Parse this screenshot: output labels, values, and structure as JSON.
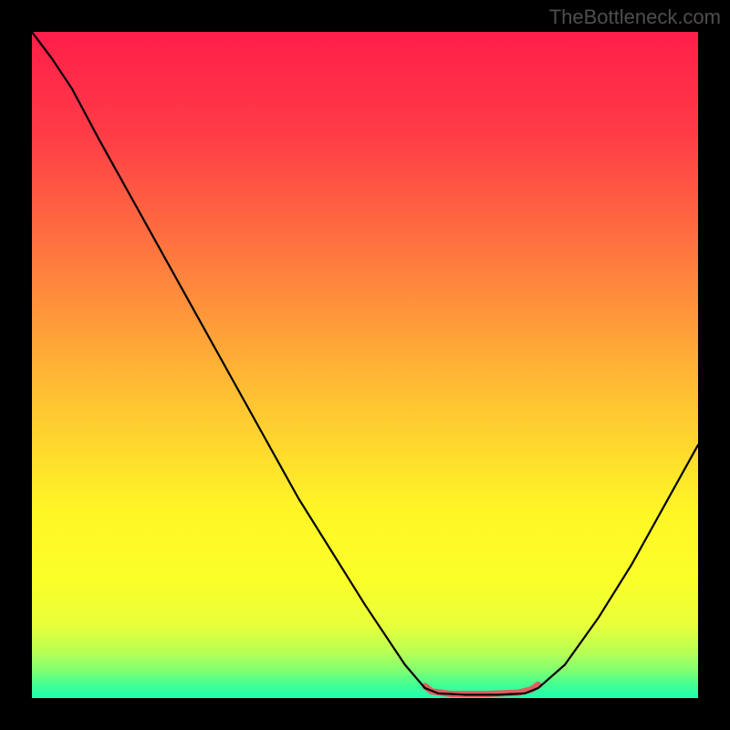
{
  "watermark": "TheBottleneck.com",
  "chart_data": {
    "type": "line",
    "title": "",
    "xlabel": "",
    "ylabel": "",
    "xlim": [
      0,
      100
    ],
    "ylim": [
      0,
      100
    ],
    "background_gradient_stops": [
      {
        "offset": 0,
        "color": "#ff1e49"
      },
      {
        "offset": 15,
        "color": "#ff3b47"
      },
      {
        "offset": 35,
        "color": "#ff7d3e"
      },
      {
        "offset": 55,
        "color": "#ffc233"
      },
      {
        "offset": 72,
        "color": "#fff626"
      },
      {
        "offset": 82,
        "color": "#fbff28"
      },
      {
        "offset": 89,
        "color": "#e8ff3a"
      },
      {
        "offset": 93,
        "color": "#baff53"
      },
      {
        "offset": 96,
        "color": "#7eff74"
      },
      {
        "offset": 98,
        "color": "#42ff93"
      },
      {
        "offset": 100,
        "color": "#1effb0"
      }
    ],
    "series": [
      {
        "name": "bottleneck-curve",
        "color": "#000000",
        "width": 2.2,
        "points": [
          {
            "x": 0,
            "y": 100
          },
          {
            "x": 3,
            "y": 96
          },
          {
            "x": 6,
            "y": 91.5
          },
          {
            "x": 10,
            "y": 84
          },
          {
            "x": 20,
            "y": 66
          },
          {
            "x": 30,
            "y": 48
          },
          {
            "x": 40,
            "y": 30
          },
          {
            "x": 50,
            "y": 14
          },
          {
            "x": 56,
            "y": 5
          },
          {
            "x": 59,
            "y": 1.5
          },
          {
            "x": 61,
            "y": 0.7
          },
          {
            "x": 65,
            "y": 0.5
          },
          {
            "x": 70,
            "y": 0.5
          },
          {
            "x": 74,
            "y": 0.7
          },
          {
            "x": 76,
            "y": 1.5
          },
          {
            "x": 80,
            "y": 5
          },
          {
            "x": 85,
            "y": 12
          },
          {
            "x": 90,
            "y": 20
          },
          {
            "x": 95,
            "y": 29
          },
          {
            "x": 100,
            "y": 38
          }
        ]
      },
      {
        "name": "optimal-range-highlight",
        "color": "#e15e5e",
        "width": 7,
        "points": [
          {
            "x": 59,
            "y": 1.8
          },
          {
            "x": 60,
            "y": 1.0
          },
          {
            "x": 63,
            "y": 0.6
          },
          {
            "x": 68,
            "y": 0.6
          },
          {
            "x": 73,
            "y": 0.8
          },
          {
            "x": 75,
            "y": 1.3
          },
          {
            "x": 76,
            "y": 2.0
          }
        ]
      }
    ]
  }
}
